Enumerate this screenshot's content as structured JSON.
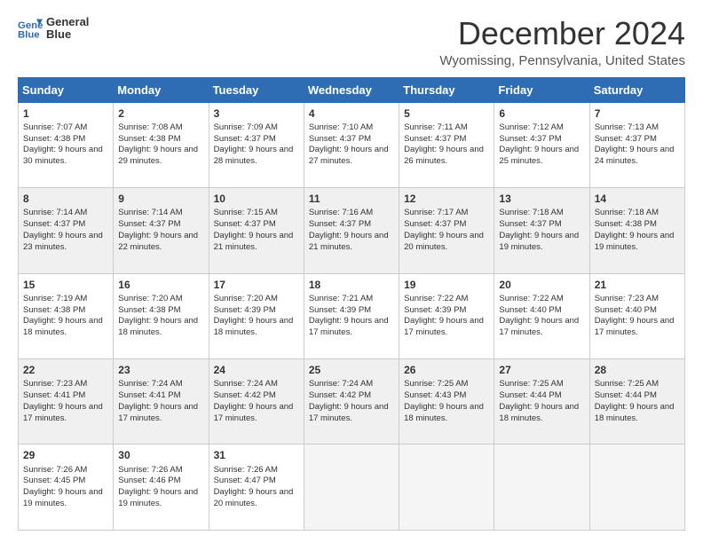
{
  "logo": {
    "line1": "General",
    "line2": "Blue"
  },
  "header": {
    "month": "December 2024",
    "location": "Wyomissing, Pennsylvania, United States"
  },
  "weekdays": [
    "Sunday",
    "Monday",
    "Tuesday",
    "Wednesday",
    "Thursday",
    "Friday",
    "Saturday"
  ],
  "weeks": [
    [
      {
        "day": "1",
        "sunrise": "7:07 AM",
        "sunset": "4:38 PM",
        "daylight": "9 hours and 30 minutes."
      },
      {
        "day": "2",
        "sunrise": "7:08 AM",
        "sunset": "4:38 PM",
        "daylight": "9 hours and 29 minutes."
      },
      {
        "day": "3",
        "sunrise": "7:09 AM",
        "sunset": "4:37 PM",
        "daylight": "9 hours and 28 minutes."
      },
      {
        "day": "4",
        "sunrise": "7:10 AM",
        "sunset": "4:37 PM",
        "daylight": "9 hours and 27 minutes."
      },
      {
        "day": "5",
        "sunrise": "7:11 AM",
        "sunset": "4:37 PM",
        "daylight": "9 hours and 26 minutes."
      },
      {
        "day": "6",
        "sunrise": "7:12 AM",
        "sunset": "4:37 PM",
        "daylight": "9 hours and 25 minutes."
      },
      {
        "day": "7",
        "sunrise": "7:13 AM",
        "sunset": "4:37 PM",
        "daylight": "9 hours and 24 minutes."
      }
    ],
    [
      {
        "day": "8",
        "sunrise": "7:14 AM",
        "sunset": "4:37 PM",
        "daylight": "9 hours and 23 minutes."
      },
      {
        "day": "9",
        "sunrise": "7:14 AM",
        "sunset": "4:37 PM",
        "daylight": "9 hours and 22 minutes."
      },
      {
        "day": "10",
        "sunrise": "7:15 AM",
        "sunset": "4:37 PM",
        "daylight": "9 hours and 21 minutes."
      },
      {
        "day": "11",
        "sunrise": "7:16 AM",
        "sunset": "4:37 PM",
        "daylight": "9 hours and 21 minutes."
      },
      {
        "day": "12",
        "sunrise": "7:17 AM",
        "sunset": "4:37 PM",
        "daylight": "9 hours and 20 minutes."
      },
      {
        "day": "13",
        "sunrise": "7:18 AM",
        "sunset": "4:37 PM",
        "daylight": "9 hours and 19 minutes."
      },
      {
        "day": "14",
        "sunrise": "7:18 AM",
        "sunset": "4:38 PM",
        "daylight": "9 hours and 19 minutes."
      }
    ],
    [
      {
        "day": "15",
        "sunrise": "7:19 AM",
        "sunset": "4:38 PM",
        "daylight": "9 hours and 18 minutes."
      },
      {
        "day": "16",
        "sunrise": "7:20 AM",
        "sunset": "4:38 PM",
        "daylight": "9 hours and 18 minutes."
      },
      {
        "day": "17",
        "sunrise": "7:20 AM",
        "sunset": "4:39 PM",
        "daylight": "9 hours and 18 minutes."
      },
      {
        "day": "18",
        "sunrise": "7:21 AM",
        "sunset": "4:39 PM",
        "daylight": "9 hours and 17 minutes."
      },
      {
        "day": "19",
        "sunrise": "7:22 AM",
        "sunset": "4:39 PM",
        "daylight": "9 hours and 17 minutes."
      },
      {
        "day": "20",
        "sunrise": "7:22 AM",
        "sunset": "4:40 PM",
        "daylight": "9 hours and 17 minutes."
      },
      {
        "day": "21",
        "sunrise": "7:23 AM",
        "sunset": "4:40 PM",
        "daylight": "9 hours and 17 minutes."
      }
    ],
    [
      {
        "day": "22",
        "sunrise": "7:23 AM",
        "sunset": "4:41 PM",
        "daylight": "9 hours and 17 minutes."
      },
      {
        "day": "23",
        "sunrise": "7:24 AM",
        "sunset": "4:41 PM",
        "daylight": "9 hours and 17 minutes."
      },
      {
        "day": "24",
        "sunrise": "7:24 AM",
        "sunset": "4:42 PM",
        "daylight": "9 hours and 17 minutes."
      },
      {
        "day": "25",
        "sunrise": "7:24 AM",
        "sunset": "4:42 PM",
        "daylight": "9 hours and 17 minutes."
      },
      {
        "day": "26",
        "sunrise": "7:25 AM",
        "sunset": "4:43 PM",
        "daylight": "9 hours and 18 minutes."
      },
      {
        "day": "27",
        "sunrise": "7:25 AM",
        "sunset": "4:44 PM",
        "daylight": "9 hours and 18 minutes."
      },
      {
        "day": "28",
        "sunrise": "7:25 AM",
        "sunset": "4:44 PM",
        "daylight": "9 hours and 18 minutes."
      }
    ],
    [
      {
        "day": "29",
        "sunrise": "7:26 AM",
        "sunset": "4:45 PM",
        "daylight": "9 hours and 19 minutes."
      },
      {
        "day": "30",
        "sunrise": "7:26 AM",
        "sunset": "4:46 PM",
        "daylight": "9 hours and 19 minutes."
      },
      {
        "day": "31",
        "sunrise": "7:26 AM",
        "sunset": "4:47 PM",
        "daylight": "9 hours and 20 minutes."
      },
      null,
      null,
      null,
      null
    ]
  ]
}
